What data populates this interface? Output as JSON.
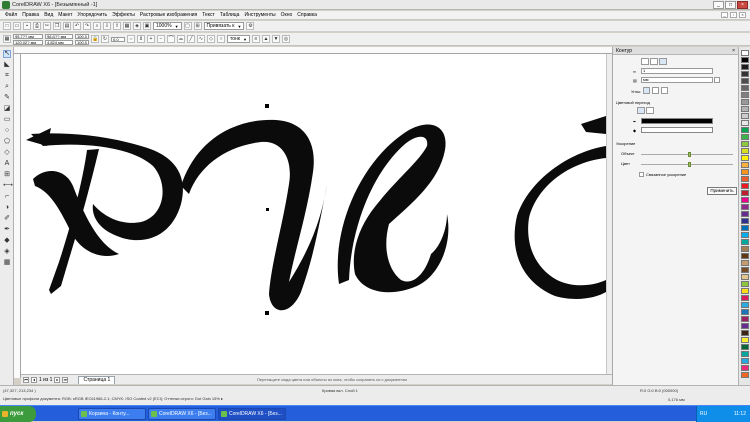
{
  "window": {
    "title": "CorelDRAW X6 - [Безымянный -1]",
    "minimize": "_",
    "maximize": "□",
    "close": "×"
  },
  "menu": [
    "Файл",
    "Правка",
    "Вид",
    "Макет",
    "Упорядочить",
    "Эффекты",
    "Растровые изображения",
    "Текст",
    "Таблица",
    "Инструменты",
    "Окно",
    "Справка"
  ],
  "toolbar": {
    "zoom": "1000%",
    "snap": "Привязать к"
  },
  "props": {
    "x": "95,7?? мм",
    "y": "120,02? мм",
    "w": "96,ß?? мм",
    "h": "4,824 мм",
    "sx": "100,0",
    "sy": "100,0",
    "angle": "0,0",
    "outline_width": "тонк"
  },
  "docker": {
    "title": "Контур",
    "width_value": "1",
    "width_unit": "мм",
    "corners_label": "Углы:",
    "color_section": "Цветовой переход",
    "grow_label": "Ускорение",
    "object_label": "Объект",
    "color_label": "Цвет",
    "linked_label": "Связанное ускорение",
    "apply_label": "Применить",
    "outline_color": "#000000",
    "fill_color": "#ffffff"
  },
  "pages": {
    "count": "1 из 1",
    "tab": "Страница 1"
  },
  "hint": "Перетащите сюда цвета или объекты из окна, чтобы сохранить их с документом",
  "status": {
    "coords": "(47,327; 213,234 )",
    "profile": "Цветовые профили документа: RGB: sRGB IEC61966-2.1; CMYK: ISO Coated v2 (ECI); Оттенки серого: Dot Gain 15% ▸",
    "object": "Кривая вкл. Слой 1",
    "fill": "R:0 G:0 B:0 (000000)",
    "outline": "0,176 мм"
  },
  "taskbar": {
    "start": "пуск",
    "tasks": [
      {
        "label": "Корзина - Конту..."
      },
      {
        "label": "CorelDRAW X6 - [Без..."
      },
      {
        "label": "CorelDRAW X6 - [Без..."
      }
    ],
    "lang": "RU",
    "time": "11:12"
  },
  "palette_colors": [
    "#ffffff",
    "#000000",
    "#1b1b1b",
    "#333333",
    "#4d4d4d",
    "#666666",
    "#808080",
    "#999999",
    "#b3b3b3",
    "#cccccc",
    "#e6e6e6",
    "#00a651",
    "#39b54a",
    "#8dc63f",
    "#d7df23",
    "#fff200",
    "#fbb040",
    "#f7941d",
    "#f15a29",
    "#ed1c24",
    "#be1e2d",
    "#ec008c",
    "#92278f",
    "#662d91",
    "#2e3192",
    "#0072bc",
    "#00aeef",
    "#00a99d",
    "#a67c52",
    "#603913",
    "#c69c6d",
    "#754c24",
    "#e3c68e",
    "#8cc63f",
    "#ffde17",
    "#d91c5c",
    "#29abe2",
    "#1b75bb",
    "#9e1f63",
    "#662d91",
    "#3c2415",
    "#f9ed32",
    "#006838",
    "#00a79d",
    "#27aae1",
    "#ee2a7b",
    "#f26522"
  ]
}
